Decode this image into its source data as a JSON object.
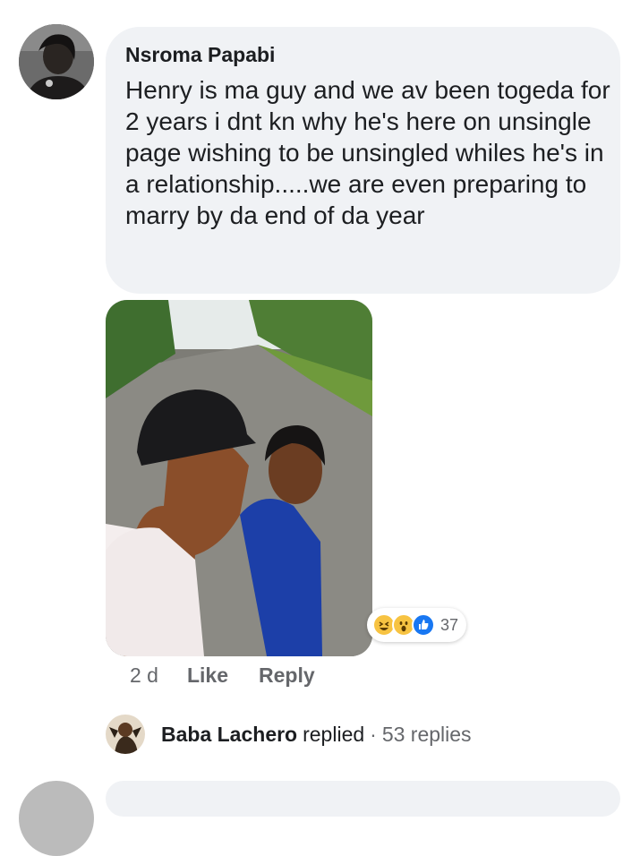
{
  "comment": {
    "author": "Nsroma Papabi",
    "text": "Henry is ma guy and we av been togeda for 2 years i dnt kn why he's here on unsingle page wishing to be unsingled whiles he's in a relationship.....we are even preparing to marry by da end of da year",
    "reactions": {
      "icons": [
        "haha-reaction-icon",
        "wow-reaction-icon",
        "like-reaction-icon"
      ],
      "count": "37"
    },
    "time": "2 d",
    "like_label": "Like",
    "reply_label": "Reply"
  },
  "replies": {
    "name": "Baba Lachero",
    "verb": "replied",
    "separator": "·",
    "count": "53 replies"
  },
  "colors": {
    "bubble": "#f0f2f5",
    "secondary_text": "#65676b",
    "like_blue": "#1877f2",
    "emoji_yellow": "#f7c342"
  }
}
